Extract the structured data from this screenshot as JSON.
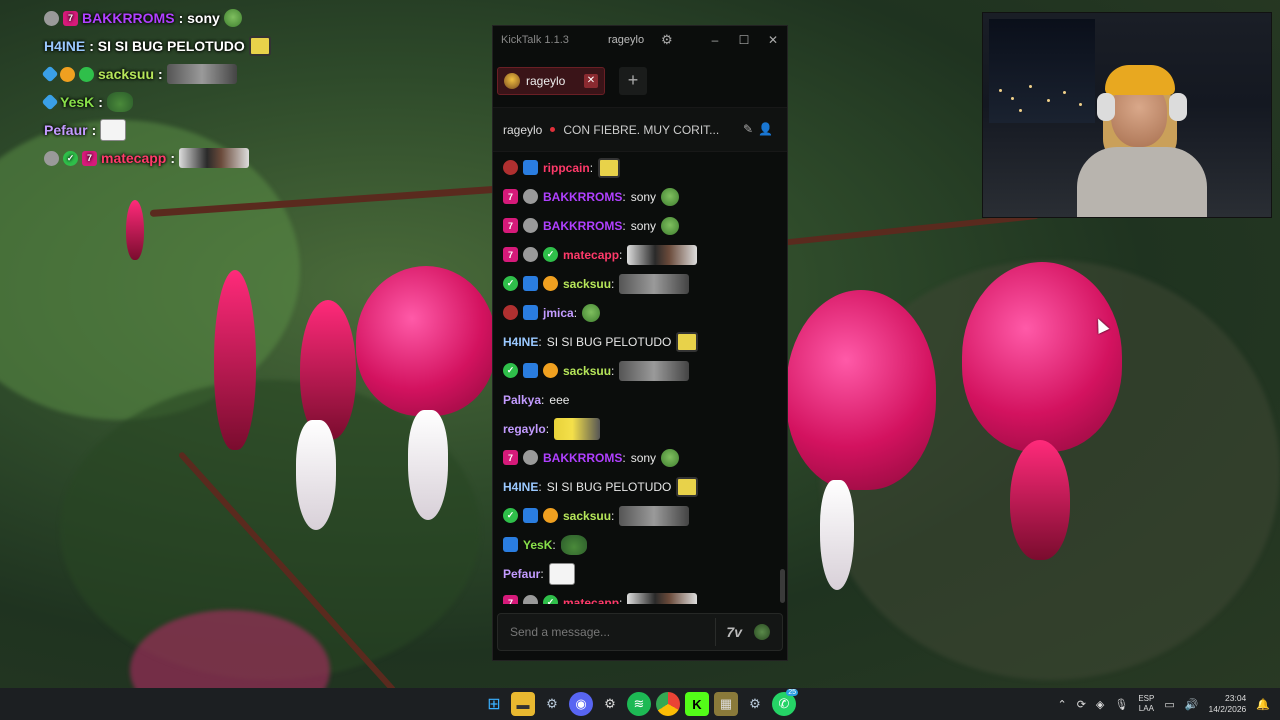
{
  "overlay": {
    "lines": [
      {
        "name": "BAKKRROMS",
        "name_color": "#b040ff",
        "message": "sony",
        "badges": [
          "gray",
          "pink"
        ],
        "emote": "frog"
      },
      {
        "name": "H4INE",
        "name_color": "#9ac8ff",
        "message": "SI SI BUG PELOTUDO",
        "badges": [],
        "emote": "sponge"
      },
      {
        "name": "sacksuu",
        "name_color": "#b6e65a",
        "message": "",
        "badges": [
          "sky",
          "orange",
          "green"
        ],
        "emote": "photo"
      },
      {
        "name": "YesK",
        "name_color": "#88e04a",
        "message": "",
        "badges": [
          "sky"
        ],
        "emote": "peepo"
      },
      {
        "name": "Pefaur",
        "name_color": "#c39bff",
        "message": "",
        "badges": [],
        "emote": "meme"
      },
      {
        "name": "matecapp",
        "name_color": "#ff3a6a",
        "message": "",
        "badges": [
          "gray",
          "green",
          "pink"
        ],
        "emote": "photo2"
      }
    ]
  },
  "kicktalk": {
    "app_title": "KickTalk 1.1.3",
    "titlebar_user": "rageylo",
    "tab_label": "rageylo",
    "add_tab": "+",
    "channel_user": "rageylo",
    "stream_title": "CON FIEBRE. MUY CORIT...",
    "input_placeholder": "Send a message...",
    "emote_picker_label": "7TV",
    "messages": [
      {
        "name": "rippcain",
        "name_color": "#ff3a6a",
        "text": "",
        "badges": [
          "red",
          "blue"
        ],
        "emote": "sponge"
      },
      {
        "name": "BAKKRROMS",
        "name_color": "#b040ff",
        "text": "sony",
        "badges": [
          "pink",
          "gray"
        ],
        "emote": "frog"
      },
      {
        "name": "BAKKRROMS",
        "name_color": "#b040ff",
        "text": "sony",
        "badges": [
          "pink",
          "gray"
        ],
        "emote": "frog"
      },
      {
        "name": "matecapp",
        "name_color": "#ff3a6a",
        "text": "",
        "badges": [
          "pink",
          "gray",
          "green"
        ],
        "emote": "photo2"
      },
      {
        "name": "sacksuu",
        "name_color": "#b6e65a",
        "text": "",
        "badges": [
          "green",
          "blue",
          "orange"
        ],
        "emote": "photo"
      },
      {
        "name": "jmica",
        "name_color": "#c39bff",
        "text": "",
        "badges": [
          "red",
          "blue"
        ],
        "emote": "frog"
      },
      {
        "name": "H4INE",
        "name_color": "#9ac8ff",
        "text": "SI SI BUG PELOTUDO",
        "badges": [],
        "emote": "sponge"
      },
      {
        "name": "sacksuu",
        "name_color": "#b6e65a",
        "text": "",
        "badges": [
          "green",
          "blue",
          "orange"
        ],
        "emote": "photo"
      },
      {
        "name": "Palkya",
        "name_color": "#c39bff",
        "text": "eee",
        "badges": [],
        "emote": ""
      },
      {
        "name": "regaylo",
        "name_color": "#c39bff",
        "text": "",
        "badges": [],
        "emote": "minion"
      },
      {
        "name": "BAKKRROMS",
        "name_color": "#b040ff",
        "text": "sony",
        "badges": [
          "pink",
          "gray"
        ],
        "emote": "frog"
      },
      {
        "name": "H4INE",
        "name_color": "#9ac8ff",
        "text": "SI SI BUG PELOTUDO",
        "badges": [],
        "emote": "sponge"
      },
      {
        "name": "sacksuu",
        "name_color": "#b6e65a",
        "text": "",
        "badges": [
          "green",
          "blue",
          "orange"
        ],
        "emote": "photo"
      },
      {
        "name": "YesK",
        "name_color": "#88e04a",
        "text": "",
        "badges": [
          "blue"
        ],
        "emote": "peepo"
      },
      {
        "name": "Pefaur",
        "name_color": "#c39bff",
        "text": "",
        "badges": [],
        "emote": "meme"
      },
      {
        "name": "matecapp",
        "name_color": "#ff3a6a",
        "text": "",
        "badges": [
          "pink",
          "gray",
          "green"
        ],
        "emote": "photo2"
      }
    ]
  },
  "taskbar": {
    "whatsapp_badge": "25",
    "lang_top": "ESP",
    "lang_bottom": "LAA",
    "time": "23:04",
    "date": "14/2/2026"
  }
}
